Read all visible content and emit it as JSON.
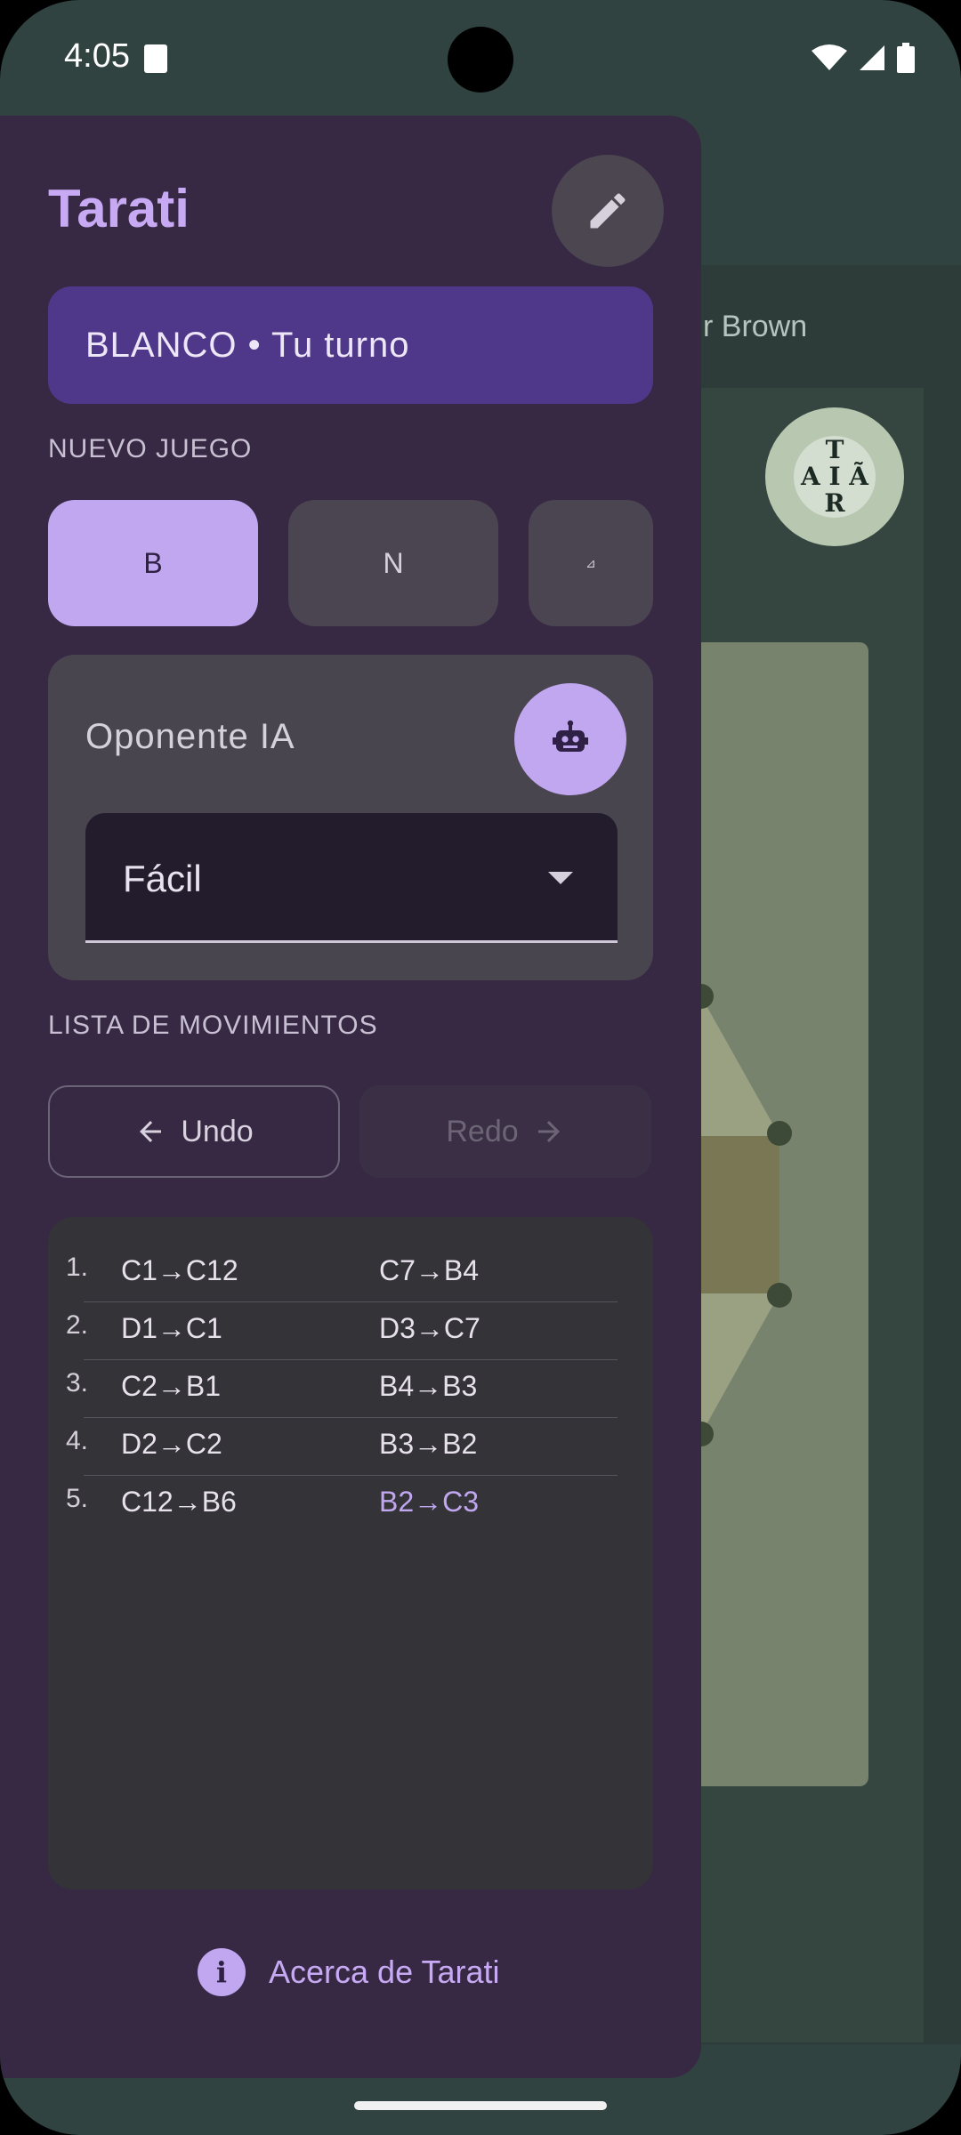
{
  "status_bar": {
    "time": "4:05"
  },
  "background_app": {
    "player_text": "r Brown",
    "logo_letters": [
      "T",
      "A",
      "I",
      "Ã",
      "R"
    ]
  },
  "drawer": {
    "title": "Tarati",
    "turn_banner": "BLANCO • Tu turno",
    "new_game_label": "NUEVO JUEGO",
    "new_game_buttons": [
      "B",
      "N",
      "⊿"
    ],
    "ai": {
      "label": "Oponente IA",
      "difficulty": "Fácil"
    },
    "moves_label": "LISTA DE MOVIMIENTOS",
    "undo_label": "Undo",
    "redo_label": "Redo",
    "moves": [
      {
        "num": "1.",
        "white": "C1→C12",
        "black": "C7→B4"
      },
      {
        "num": "2.",
        "white": "D1→C1",
        "black": "D3→C7"
      },
      {
        "num": "3.",
        "white": "C2→B1",
        "black": "B4→B3"
      },
      {
        "num": "4.",
        "white": "D2→C2",
        "black": "B3→B2"
      },
      {
        "num": "5.",
        "white": "C12→B6",
        "black": "B2→C3"
      }
    ],
    "about_label": "Acerca de Tarati"
  },
  "colors": {
    "accent": "#c0a7f0",
    "drawer_bg": "#372944",
    "banner_bg": "#4f378a"
  }
}
